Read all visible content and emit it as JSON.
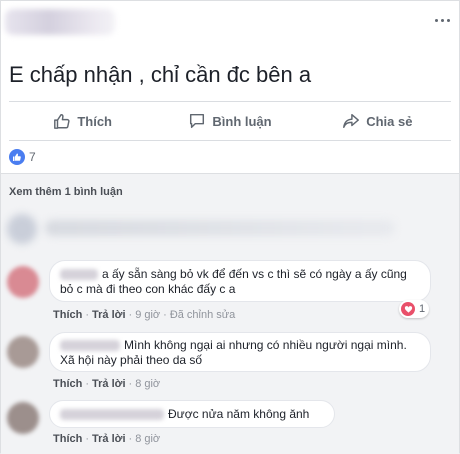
{
  "post": {
    "text": "E chấp nhận , chỉ cần đc bên a",
    "more_icon": "more-dots-icon"
  },
  "actions": {
    "like": {
      "label": "Thích",
      "icon": "thumbs-up-icon"
    },
    "comment": {
      "label": "Bình luận",
      "icon": "comment-icon"
    },
    "share": {
      "label": "Chia sẻ",
      "icon": "share-icon"
    }
  },
  "reactions": {
    "count": "7",
    "icon": "like-reaction-icon",
    "color": "#4a7df0"
  },
  "comments_section": {
    "view_more": "Xem thêm 1 bình luận",
    "comments": [
      {
        "text": "a ấy sẵn sàng bỏ vk để đến vs c thì sẽ có ngày a ấy cũng bỏ c mà đi theo con khác đấy c a",
        "like_label": "Thích",
        "reply_label": "Trả lời",
        "time": "9 giờ",
        "edited": "Đã chỉnh sửa",
        "reaction_count": "1",
        "reaction_icon": "heart-icon",
        "reaction_color": "#e9506a"
      },
      {
        "text": "Mình không ngại ai nhưng có nhiều người ngại mình. Xã hội này phải theo da số",
        "like_label": "Thích",
        "reply_label": "Trả lời",
        "time": "8 giờ"
      },
      {
        "text": "Được nửa năm không ănh",
        "like_label": "Thích",
        "reply_label": "Trả lời",
        "time": "8 giờ"
      }
    ]
  }
}
